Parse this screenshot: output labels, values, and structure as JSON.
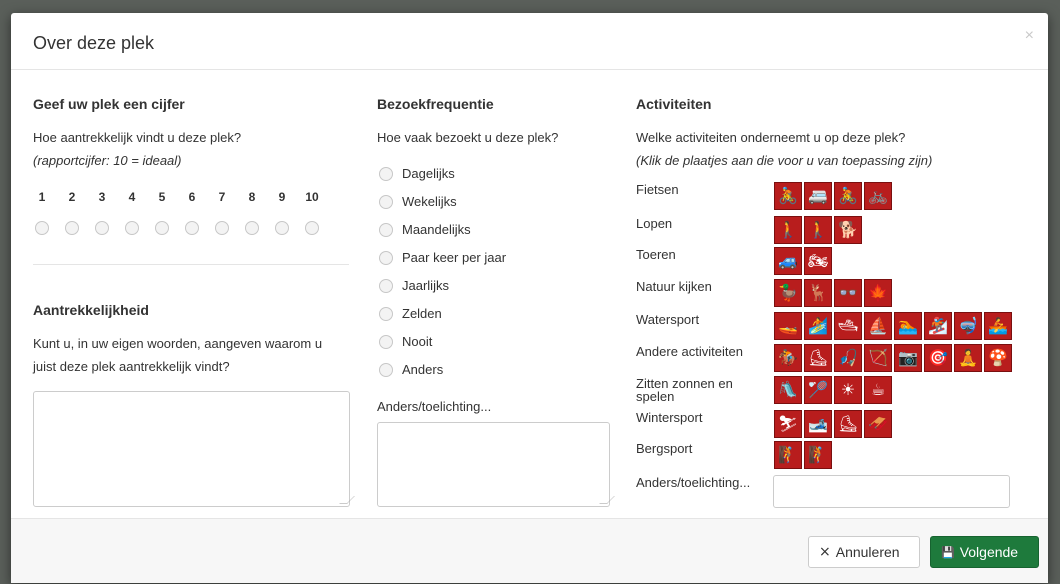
{
  "modal": {
    "title": "Over deze plek",
    "close_label": "×"
  },
  "rating": {
    "heading": "Geef uw plek een cijfer",
    "question": "Hoe aantrekkelijk vindt u deze plek?",
    "hint": "(rapportcijfer: 10 = ideaal)",
    "numbers": [
      "1",
      "2",
      "3",
      "4",
      "5",
      "6",
      "7",
      "8",
      "9",
      "10"
    ]
  },
  "attractiveness": {
    "heading": "Aantrekkelijkheid",
    "question_line1": "Kunt u, in uw eigen woorden, aangeven waarom u",
    "question_line2": "juist deze plek aantrekkelijk vindt?"
  },
  "frequency": {
    "heading": "Bezoekfrequentie",
    "question": "Hoe vaak bezoekt u deze plek?",
    "options": [
      "Dagelijks",
      "Wekelijks",
      "Maandelijks",
      "Paar keer per jaar",
      "Jaarlijks",
      "Zelden",
      "Nooit",
      "Anders"
    ],
    "other_label": "Anders/toelichting..."
  },
  "activities": {
    "heading": "Activiteiten",
    "question": "Welke activiteiten onderneemt u op deze plek?",
    "hint": "(Klik de plaatjes aan die voor u van toepassing zijn)",
    "groups": [
      {
        "label": "Fietsen",
        "icons": [
          "🚴",
          "🚐",
          "🚴",
          "🚲"
        ]
      },
      {
        "label": "Lopen",
        "icons": [
          "🚶",
          "🚶",
          "🐕"
        ]
      },
      {
        "label": "Toeren",
        "icons": [
          "🚙",
          "🏍"
        ]
      },
      {
        "label": "Natuur kijken",
        "icons": [
          "🦆",
          "🦌",
          "👓",
          "🍁"
        ]
      },
      {
        "label": "Watersport",
        "icons": [
          "🚤",
          "🏄",
          "🛥",
          "⛵",
          "🏊",
          "🏂",
          "🤿",
          "🚣"
        ]
      },
      {
        "label": "Andere activiteiten",
        "icons": [
          "🏇",
          "⛸",
          "🎣",
          "🏹",
          "📷",
          "🎯",
          "🧘",
          "🍄"
        ]
      },
      {
        "label": "Zitten zonnen en spelen",
        "icons": [
          "🛝",
          "🏸",
          "☀",
          "☕"
        ]
      },
      {
        "label": "Wintersport",
        "icons": [
          "⛷",
          "🎿",
          "⛸",
          "🛷"
        ]
      },
      {
        "label": "Bergsport",
        "icons": [
          "🧗",
          "🧗"
        ]
      }
    ],
    "other_label": "Anders/toelichting..."
  },
  "footer": {
    "cancel_label": "Annuleren",
    "cancel_icon": "×",
    "next_label": "Volgende",
    "next_icon": "💾"
  },
  "colors": {
    "icon_red": "#b81d1d",
    "next_green": "#1e7a3c"
  }
}
